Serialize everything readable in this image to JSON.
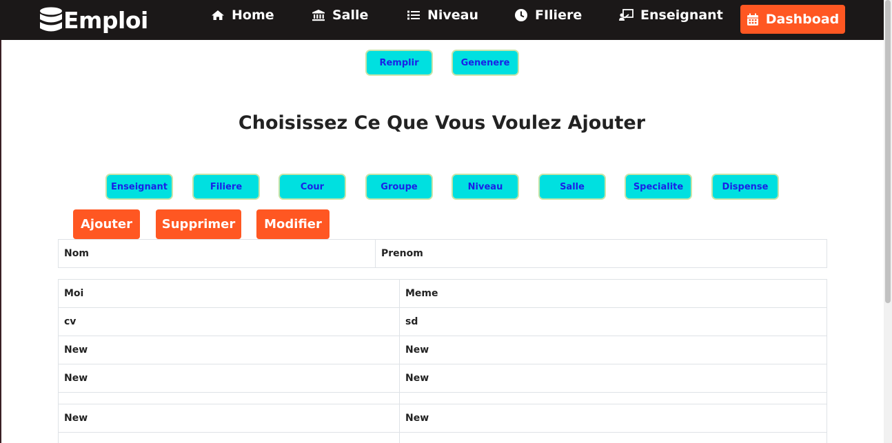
{
  "navbar": {
    "brand": "Emploi",
    "items": [
      {
        "label": "Home",
        "icon": "home-icon"
      },
      {
        "label": "Salle",
        "icon": "bank-icon"
      },
      {
        "label": "Niveau",
        "icon": "list-icon"
      },
      {
        "label": "FIliere",
        "icon": "clock-icon"
      },
      {
        "label": "Enseignant",
        "icon": "teacher-icon"
      }
    ],
    "dashboard_label": "Dashboad",
    "background": "#1b1818",
    "accent": "#ff5722"
  },
  "top_actions": {
    "remplir": "Remplir",
    "genenere": "Genenere"
  },
  "heading": "Choisissez Ce Que Vous Voulez Ajouter",
  "categories": [
    "Enseignant",
    "Filiere",
    "Cour",
    "Groupe",
    "Niveau",
    "Salle",
    "Specialite",
    "Dispense"
  ],
  "crud_actions": {
    "ajouter": "Ajouter",
    "supprimer": "Supprimer",
    "modifier": "Modifier"
  },
  "table": {
    "headers": [
      "Nom",
      "Prenom"
    ],
    "rows": [
      [
        "Moi",
        "Meme"
      ],
      [
        "cv",
        "sd"
      ],
      [
        "New",
        "New"
      ],
      [
        "New",
        "New"
      ],
      [
        "",
        ""
      ],
      [
        "New",
        "New"
      ],
      [
        "",
        ""
      ]
    ]
  },
  "colors": {
    "teal_button": "#00e0e0",
    "teal_button_text": "#1a22e6",
    "orange_button": "#ff5722"
  }
}
